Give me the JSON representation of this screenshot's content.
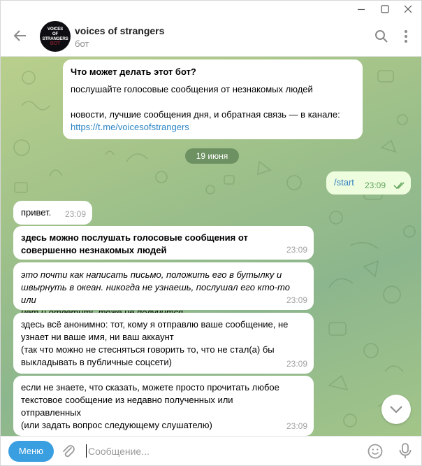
{
  "window": {
    "controls": [
      "minimize-icon",
      "maximize-icon",
      "close-icon"
    ]
  },
  "header": {
    "title": "voices of strangers",
    "subtitle": "бот",
    "avatar_text": [
      "VOICES",
      "OF STRANGERS",
      "BOT"
    ]
  },
  "intro": {
    "title": "Что может делать этот бот?",
    "line1": "послушайте голосовые сообщения от незнакомых людей",
    "line2": "новости, лучшие сообщения дня, и обратная связь — в канале:",
    "link": "https://t.me/voicesofstrangers"
  },
  "date_separator": "19 июня",
  "outgoing": {
    "text": "/start",
    "time": "23:09",
    "status": "read"
  },
  "messages": [
    {
      "lines": [
        "привет."
      ],
      "time": "23:09"
    },
    {
      "lines": [
        "здесь можно послушать голосовые сообщения от",
        "совершенно незнакомых людей"
      ],
      "time": "23:09"
    },
    {
      "lines": [
        "это почти как написать письмо, положить его в бутылку и",
        "швырнуть в океан. никогда не узнаешь, послушал его кто-то или",
        "нет и ответить тоже не получится."
      ],
      "time": "23:09"
    },
    {
      "lines": [
        "здесь всё анонимно: тот, кому я отправлю ваше сообщение, не",
        "узнает ни ваше имя, ни ваш аккаунт",
        "(так что можно не стесняться говорить то, что не стал(а) бы",
        "выкладывать в публичные соцсети)"
      ],
      "time": "23:09"
    },
    {
      "lines": [
        "если не знаете, что сказать, можете просто прочитать любое",
        "текстовое сообщение из недавно полученных или",
        "отправленных",
        "(или задать вопрос следующему слушателю)"
      ],
      "time": "23:09"
    }
  ],
  "composer": {
    "menu_label": "Меню",
    "placeholder": "Сообщение..."
  },
  "colors": {
    "accent": "#3a9fe0",
    "link": "#2a84c5",
    "outgoing_bubble": "#effddf",
    "read_check": "#5fa35a",
    "chat_bg": "#9fc18a"
  }
}
